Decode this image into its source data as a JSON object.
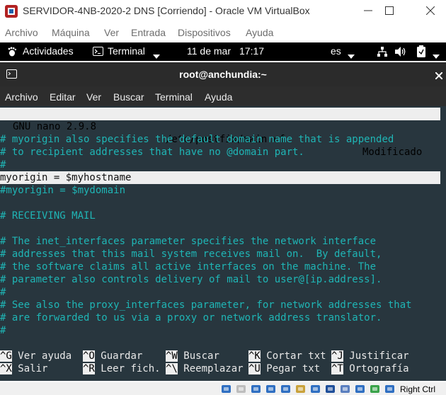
{
  "window": {
    "title": "SERVIDOR-4NB-2020-2 DNS [Corriendo] - Oracle VM VirtualBox"
  },
  "vbox_menu": [
    "Archivo",
    "Máquina",
    "Ver",
    "Entrada",
    "Dispositivos",
    "Ayuda"
  ],
  "gnome": {
    "activities": "Actividades",
    "app": "Terminal",
    "date": "11 de mar",
    "time": "17:17",
    "lang": "es"
  },
  "terminal": {
    "title": "root@anchundia:~",
    "menu": [
      "Archivo",
      "Editar",
      "Ver",
      "Buscar",
      "Terminal",
      "Ayuda"
    ]
  },
  "nano": {
    "version": "GNU nano 2.9.8",
    "file": "/etc/postfix/main.cf",
    "state": "Modificado",
    "lines": [
      {
        "text": "",
        "kind": "normal"
      },
      {
        "text": "# myorigin also specifies the default domain name that is appended",
        "kind": "comment"
      },
      {
        "text": "# to recipient addresses that have no @domain part.",
        "kind": "comment"
      },
      {
        "text": "#",
        "kind": "comment"
      },
      {
        "text": "myorigin = $myhostname",
        "kind": "highlight"
      },
      {
        "text": "#myorigin = $mydomain",
        "kind": "comment"
      },
      {
        "text": "",
        "kind": "normal"
      },
      {
        "text": "# RECEIVING MAIL",
        "kind": "comment"
      },
      {
        "text": "",
        "kind": "normal"
      },
      {
        "text": "# The inet_interfaces parameter specifies the network interface",
        "kind": "comment"
      },
      {
        "text": "# addresses that this mail system receives mail on.  By default,",
        "kind": "comment"
      },
      {
        "text": "# the software claims all active interfaces on the machine. The",
        "kind": "comment"
      },
      {
        "text": "# parameter also controls delivery of mail to user@[ip.address].",
        "kind": "comment"
      },
      {
        "text": "#",
        "kind": "comment"
      },
      {
        "text": "# See also the proxy_interfaces parameter, for network addresses that",
        "kind": "comment"
      },
      {
        "text": "# are forwarded to us via a proxy or network address translator.",
        "kind": "comment"
      },
      {
        "text": "#",
        "kind": "comment"
      }
    ],
    "shortcuts_row1": [
      {
        "key": "^G",
        "label": "Ver ayuda"
      },
      {
        "key": "^O",
        "label": "Guardar"
      },
      {
        "key": "^W",
        "label": "Buscar"
      },
      {
        "key": "^K",
        "label": "Cortar txt"
      },
      {
        "key": "^J",
        "label": "Justificar"
      }
    ],
    "shortcuts_row2": [
      {
        "key": "^X",
        "label": "Salir"
      },
      {
        "key": "^R",
        "label": "Leer fich."
      },
      {
        "key": "^\\",
        "label": "Reemplazar"
      },
      {
        "key": "^U",
        "label": "Pegar txt"
      },
      {
        "key": "^T",
        "label": "Ortografía"
      }
    ]
  },
  "statusbar": {
    "host_key": "Right Ctrl"
  },
  "colors": {
    "terminal_bg": "#28363e",
    "comment": "#1fb5b5",
    "highlight_bg": "#eeeeee"
  }
}
